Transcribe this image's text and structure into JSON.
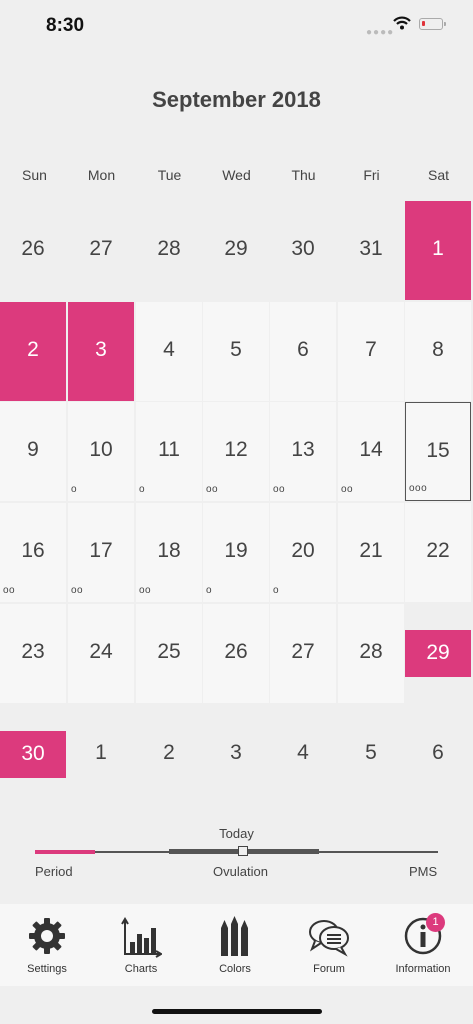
{
  "status": {
    "time": "8:30"
  },
  "calendar": {
    "month_title": "September 2018",
    "weekdays": [
      "Sun",
      "Mon",
      "Tue",
      "Wed",
      "Thu",
      "Fri",
      "Sat"
    ],
    "weeks": [
      [
        {
          "d": "26",
          "cur": false
        },
        {
          "d": "27",
          "cur": false
        },
        {
          "d": "28",
          "cur": false
        },
        {
          "d": "29",
          "cur": false
        },
        {
          "d": "30",
          "cur": false
        },
        {
          "d": "31",
          "cur": false
        },
        {
          "d": "1",
          "cur": true,
          "period": true
        }
      ],
      [
        {
          "d": "2",
          "cur": true,
          "period": true
        },
        {
          "d": "3",
          "cur": true,
          "period": true
        },
        {
          "d": "4",
          "cur": true
        },
        {
          "d": "5",
          "cur": true
        },
        {
          "d": "6",
          "cur": true
        },
        {
          "d": "7",
          "cur": true
        },
        {
          "d": "8",
          "cur": true
        }
      ],
      [
        {
          "d": "9",
          "cur": true
        },
        {
          "d": "10",
          "cur": true,
          "dots": "o"
        },
        {
          "d": "11",
          "cur": true,
          "dots": "o"
        },
        {
          "d": "12",
          "cur": true,
          "dots": "oo"
        },
        {
          "d": "13",
          "cur": true,
          "dots": "oo"
        },
        {
          "d": "14",
          "cur": true,
          "dots": "oo"
        },
        {
          "d": "15",
          "cur": true,
          "dots": "ooo",
          "today": true
        }
      ],
      [
        {
          "d": "16",
          "cur": true,
          "dots": "oo"
        },
        {
          "d": "17",
          "cur": true,
          "dots": "oo"
        },
        {
          "d": "18",
          "cur": true,
          "dots": "oo"
        },
        {
          "d": "19",
          "cur": true,
          "dots": "o"
        },
        {
          "d": "20",
          "cur": true,
          "dots": "o"
        },
        {
          "d": "21",
          "cur": true
        },
        {
          "d": "22",
          "cur": true
        }
      ],
      [
        {
          "d": "23",
          "cur": true
        },
        {
          "d": "24",
          "cur": true
        },
        {
          "d": "25",
          "cur": true
        },
        {
          "d": "26",
          "cur": true
        },
        {
          "d": "27",
          "cur": true
        },
        {
          "d": "28",
          "cur": true
        },
        {
          "d": "29",
          "cur": true,
          "band": true
        }
      ],
      [
        {
          "d": "30",
          "cur": true,
          "band": true
        },
        {
          "d": "1",
          "cur": false
        },
        {
          "d": "2",
          "cur": false
        },
        {
          "d": "3",
          "cur": false
        },
        {
          "d": "4",
          "cur": false
        },
        {
          "d": "5",
          "cur": false
        },
        {
          "d": "6",
          "cur": false
        }
      ]
    ]
  },
  "timeline": {
    "today_label": "Today",
    "period_label": "Period",
    "ovulation_label": "Ovulation",
    "pms_label": "PMS"
  },
  "tabs": [
    {
      "label": "Settings",
      "icon": "gear-icon"
    },
    {
      "label": "Charts",
      "icon": "bar-chart-icon"
    },
    {
      "label": "Colors",
      "icon": "pencils-icon"
    },
    {
      "label": "Forum",
      "icon": "chat-bubbles-icon"
    },
    {
      "label": "Information",
      "icon": "info-icon",
      "badge": "1"
    }
  ],
  "colors": {
    "accent": "#dc3a7d",
    "cell": "#f7f7f7",
    "background": "#efefef"
  }
}
